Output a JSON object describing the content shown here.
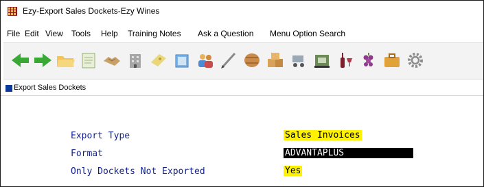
{
  "window": {
    "title": "Ezy-Export Sales Dockets-Ezy Wines"
  },
  "menu": {
    "items": [
      "File",
      "Edit",
      "View",
      "Tools",
      "Help",
      "Training Notes",
      "Ask a Question",
      "Menu Option Search"
    ]
  },
  "toolbar": {
    "icons": [
      "back-arrow-icon",
      "forward-arrow-icon",
      "folder-open-icon",
      "notepad-icon",
      "handshake-icon",
      "building-icon",
      "ticket-icon",
      "document-stack-icon",
      "people-icon",
      "pen-icon",
      "barrel-icon",
      "boxes-icon",
      "harvester-icon",
      "winery-icon",
      "wine-bottles-icon",
      "grapes-icon",
      "briefcase-icon",
      "gear-icon"
    ]
  },
  "panel": {
    "title": "Export Sales Dockets"
  },
  "form": {
    "export_type": {
      "label": "Export Type",
      "value": "Sales Invoices"
    },
    "format": {
      "label": "Format",
      "value": "ADVANTAPLUS"
    },
    "only_not_exported": {
      "label": "Only Dockets Not Exported",
      "value": "Yes"
    }
  },
  "colors": {
    "label": "#0f1f8f",
    "highlight": "#fff200",
    "selected": "#000000",
    "panel_accent": "#0b3a9c"
  }
}
